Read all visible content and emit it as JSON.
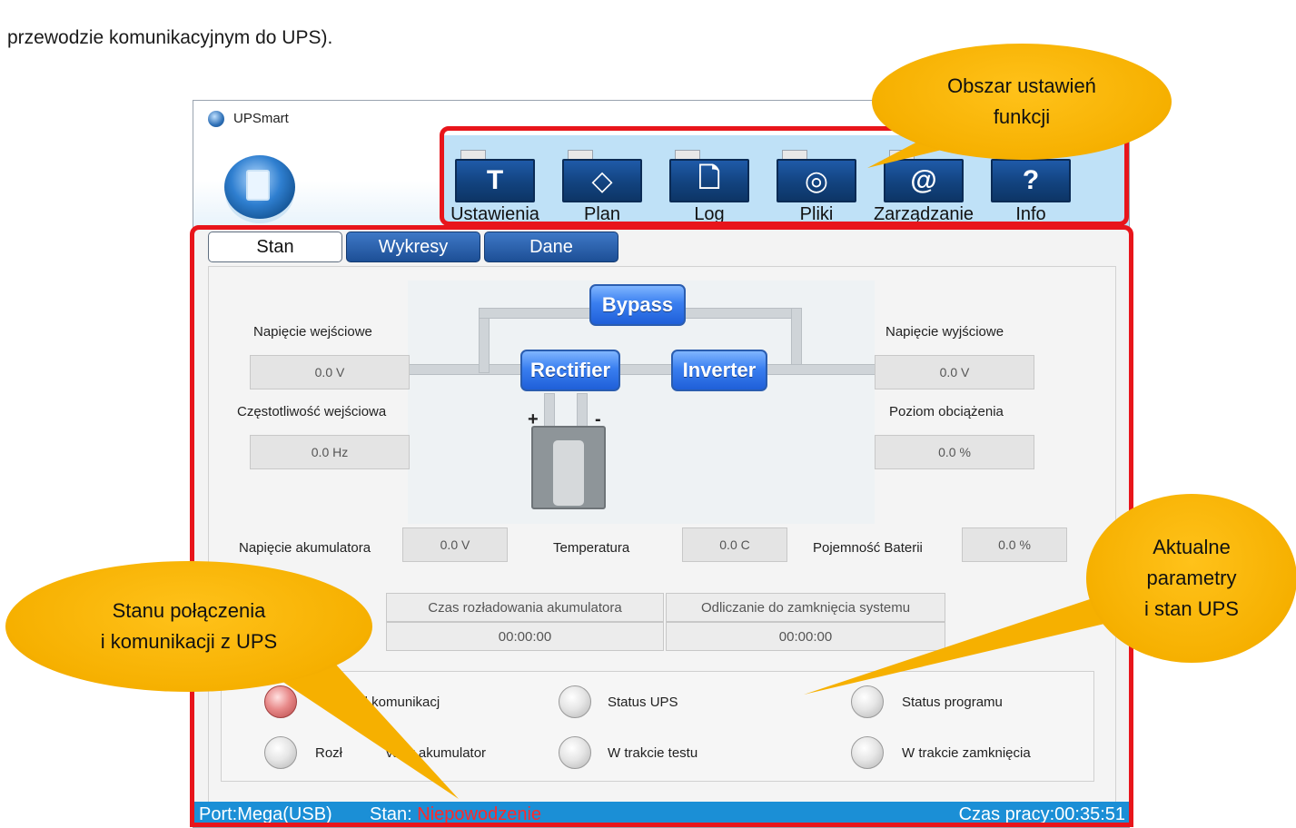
{
  "document": {
    "text": "przewodzie komunikacyjnym do UPS)."
  },
  "window": {
    "title": "UPSmart"
  },
  "toolbar": {
    "buttons": [
      {
        "label": "Ustawienia",
        "icon": "hammer-icon",
        "glyph": "T"
      },
      {
        "label": "Plan",
        "icon": "schedule-icon",
        "glyph": "◇"
      },
      {
        "label": "Log",
        "icon": "log-document-icon",
        "glyph": "🗋"
      },
      {
        "label": "Pliki",
        "icon": "files-disc-icon",
        "glyph": "◎"
      },
      {
        "label": "Zarządzanie",
        "icon": "management-at-icon",
        "glyph": "@"
      },
      {
        "label": "Info",
        "icon": "info-question-icon",
        "glyph": "?"
      }
    ]
  },
  "tabs": {
    "stan": "Stan",
    "wykresy": "Wykresy",
    "dane": "Dane"
  },
  "diagram": {
    "bypass": "Bypass",
    "rectifier": "Rectifier",
    "inverter": "Inverter",
    "plus": "+",
    "minus": "-"
  },
  "readings": {
    "input_voltage_label": "Napięcie wejściowe",
    "input_voltage_value": "0.0 V",
    "input_freq_label": "Częstotliwość wejściowa",
    "input_freq_value": "0.0 Hz",
    "output_voltage_label": "Napięcie wyjściowe",
    "output_voltage_value": "0.0 V",
    "load_label": "Poziom obciążenia",
    "load_value": "0.0 %",
    "battery_voltage_label": "Napięcie akumulatora",
    "battery_voltage_value": "0.0 V",
    "temperature_label": "Temperatura",
    "temperature_value": "0.0 C",
    "battery_capacity_label": "Pojemność Baterii",
    "battery_capacity_value": "0.0 %"
  },
  "timers": {
    "discharge_label": "Czas rozładowania akumulatora",
    "discharge_value": "00:00:00",
    "shutdown_label": "Odliczanie do zamknięcia systemu",
    "shutdown_value": "00:00:00"
  },
  "indicators": {
    "comm_error": "łąd komunikacj",
    "ups_status": "Status UPS",
    "program_status": "Status programu",
    "battery_discharged_left": "Rozł",
    "battery_discharged_right": "vany akumulator",
    "in_test": "W trakcie testu",
    "shutting_down": "W trakcie zamknięcia"
  },
  "statusbar": {
    "port": "Port:Mega(USB)",
    "stan_label": "Stan: ",
    "stan_value": "Niepowodzenie",
    "uptime": "Czas pracy:00:35:51"
  },
  "callouts": {
    "settings_line1": "Obszar ustawień",
    "settings_line2": "funkcji",
    "params_line1": "Aktualne",
    "params_line2": "parametry",
    "params_line3": "i stan UPS",
    "conn_line1": "Stanu połączenia",
    "conn_line2": "i  komunikacji z UPS"
  },
  "colors": {
    "highlight_red": "#e8151b",
    "callout_yellow": "#f6b000",
    "statusbar_blue": "#1b8fd6",
    "error_red": "#ff2a2a",
    "toolbar_blue": "#1f5aa8"
  }
}
